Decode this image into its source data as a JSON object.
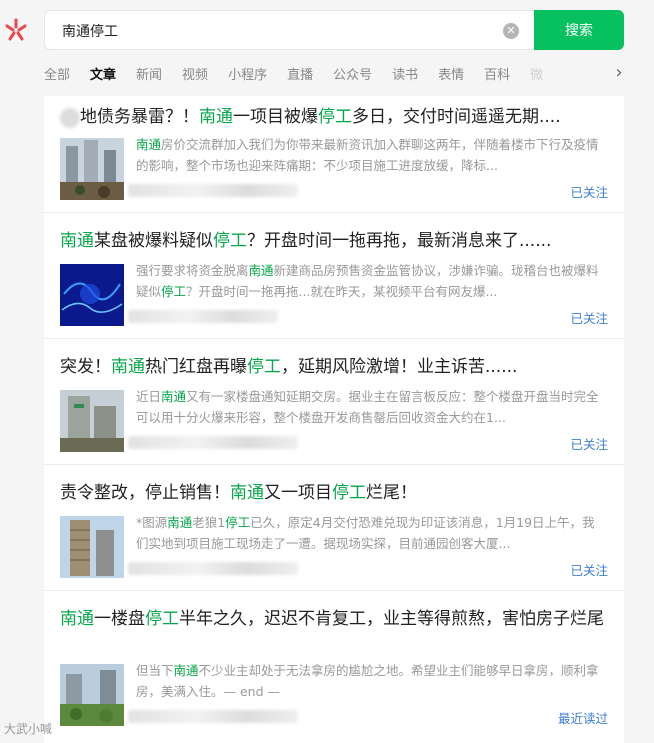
{
  "search": {
    "query": "南通停工",
    "clear_icon": "clear-icon",
    "button_label": "搜索"
  },
  "tabs": [
    {
      "label": "全部"
    },
    {
      "label": "文章",
      "active": true
    },
    {
      "label": "新闻"
    },
    {
      "label": "视频"
    },
    {
      "label": "小程序"
    },
    {
      "label": "直播"
    },
    {
      "label": "公众号"
    },
    {
      "label": "读书"
    },
    {
      "label": "表情"
    },
    {
      "label": "百科"
    },
    {
      "label": "微"
    }
  ],
  "results": [
    {
      "title_parts": [
        "地债务暴雷？！",
        "南通",
        "一项目被爆",
        "停工",
        "多日，交付时间遥遥无期...."
      ],
      "desc_parts": [
        "",
        "南通",
        "房价交流群加入我们为你带来最新资讯加入群聊这两年，伴随着楼市下行及疫情的影响，整个市场也迎来阵痛期：不少项目施工进度放缓，降标..."
      ],
      "status": "已关注"
    },
    {
      "title_parts": [
        "",
        "南通",
        "某盘被爆料疑似",
        "停工",
        "？开盘时间一拖再拖，最新消息来了......"
      ],
      "desc_parts": [
        "强行要求将资金脱离",
        "南通",
        "新建商品房预售资金监管协议，涉嫌诈骗。珑稽台也被爆料疑似",
        "停工",
        "？开盘时间一拖再拖...就在昨天，某视频平台有网友爆..."
      ],
      "status": "已关注"
    },
    {
      "title_parts": [
        "突发！",
        "南通",
        "热门红盘再曝",
        "停工",
        "，延期风险激增！业主诉苦......"
      ],
      "desc_parts": [
        "近日",
        "南通",
        "又有一家楼盘通知延期交房。据业主在留言板反应：整个楼盘开盘当时完全可以用十分火爆来形容，整个楼盘开发商售罄后回收资金大约在1..."
      ],
      "status": "已关注"
    },
    {
      "title_parts": [
        "责令整改，停止销售！",
        "南通",
        "又一项目",
        "停工",
        "烂尾！"
      ],
      "desc_parts": [
        "*图源",
        "南通",
        "老狼1",
        "停工",
        "已久，原定4月交付恐难兑现为印证该消息，1月19日上午，我们实地到项目施工现场走了一遭。据现场实探，目前通园创客大厦..."
      ],
      "status": "已关注"
    },
    {
      "title_parts": [
        "",
        "南通",
        "一楼盘",
        "停工",
        "半年之久，迟迟不肯复工，业主等得煎熬，害怕房子烂尾"
      ],
      "desc_parts": [
        "但当下",
        "南通",
        "不少业主却处于无法拿房的尴尬之地。希望业主们能够早日拿房，顺利拿房，美满入住。— end —"
      ],
      "status": "最近读过"
    }
  ],
  "watermark": "大武小喊"
}
